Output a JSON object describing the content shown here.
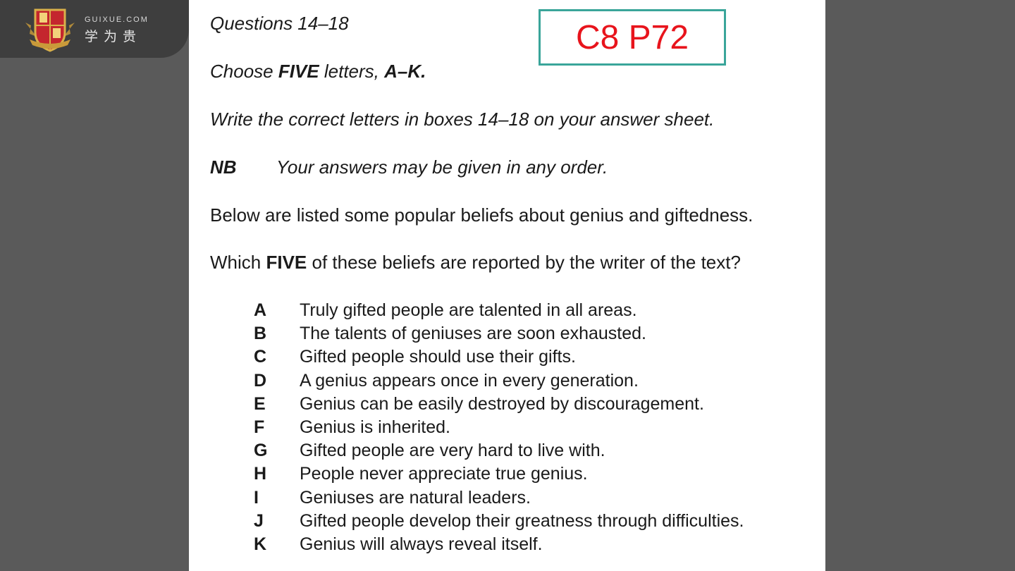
{
  "logo": {
    "site": "GUIXUE.COM",
    "name_cn": "学为贵"
  },
  "reference_label": "C8 P72",
  "page": {
    "questions_title": "Questions 14–18",
    "instruction_pre": "Choose ",
    "instruction_bold1": "FIVE",
    "instruction_mid": " letters, ",
    "instruction_bold2": "A–K.",
    "write_instruction": "Write the correct letters in boxes 14–18 on your answer sheet.",
    "nb_label": "NB",
    "nb_text": "Your answers may be given in any order.",
    "below_text": "Below are listed some popular beliefs about genius and giftedness.",
    "which_pre": "Which ",
    "which_bold": "FIVE",
    "which_post": " of these beliefs are reported by the writer of the text?",
    "options": [
      {
        "letter": "A",
        "text": "Truly gifted people are talented in all areas."
      },
      {
        "letter": "B",
        "text": "The talents of geniuses are soon exhausted."
      },
      {
        "letter": "C",
        "text": "Gifted people should use their gifts."
      },
      {
        "letter": "D",
        "text": "A genius appears once in every generation."
      },
      {
        "letter": "E",
        "text": "Genius can be easily destroyed by discouragement."
      },
      {
        "letter": "F",
        "text": "Genius is inherited."
      },
      {
        "letter": "G",
        "text": "Gifted people are very hard to live with."
      },
      {
        "letter": "H",
        "text": "People never appreciate true genius."
      },
      {
        "letter": "I",
        "text": "Geniuses are natural leaders."
      },
      {
        "letter": "J",
        "text": "Gifted people develop their greatness through difficulties."
      },
      {
        "letter": "K",
        "text": "Genius will always reveal itself."
      }
    ]
  },
  "colors": {
    "background": "#5a5a5a",
    "reference_border": "#3aa59a",
    "reference_text": "#e8141c"
  }
}
